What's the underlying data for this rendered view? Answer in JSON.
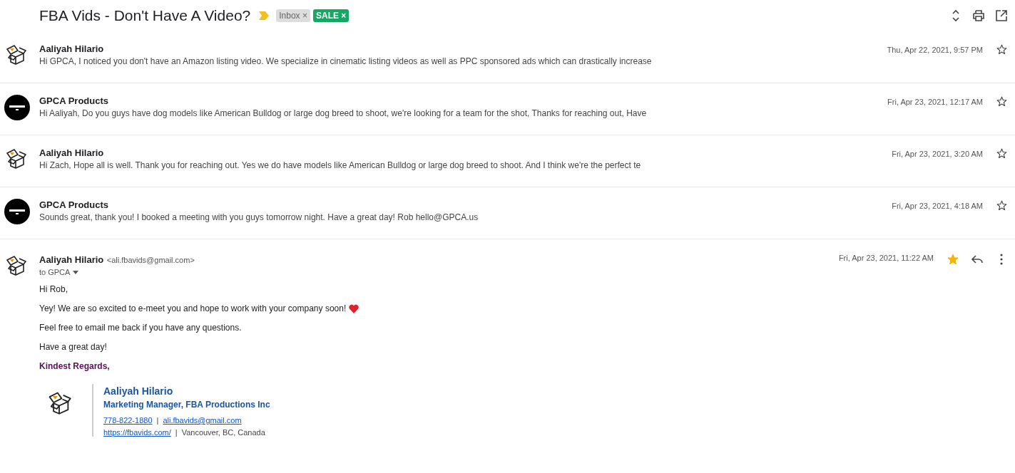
{
  "thread": {
    "subject": "FBA Vids - Don't Have A Video?",
    "important": true,
    "labels": [
      {
        "text": "Inbox",
        "kind": "inbox",
        "x": "×"
      },
      {
        "text": "SALE",
        "kind": "sale",
        "x": "×"
      }
    ]
  },
  "messages": [
    {
      "kind": "box",
      "sender": "Aaliyah Hilario",
      "snippet": "Hi GPCA, I noticed you don't have an Amazon listing video. We specialize in cinematic listing videos as well as PPC sponsored ads which can drastically increase",
      "date": "Thu, Apr 22, 2021, 9:57 PM",
      "starred": false
    },
    {
      "kind": "logo",
      "sender": "GPCA Products",
      "snippet": "Hi Aaliyah, Do you guys have dog models like American Bulldog or large dog breed to shoot, we're looking for a team for the shot, Thanks for reaching out, Have",
      "date": "Fri, Apr 23, 2021, 12:17 AM",
      "starred": false
    },
    {
      "kind": "box",
      "sender": "Aaliyah Hilario",
      "snippet": "Hi Zach, Hope all is well. Thank you for reaching out. Yes we do have models like American Bulldog or large dog breed to shoot. And I think we're the perfect te",
      "date": "Fri, Apr 23, 2021, 3:20 AM",
      "starred": false
    },
    {
      "kind": "logo",
      "sender": "GPCA Products",
      "snippet": "Sounds great, thank you! I booked a meeting with you guys tomorrow night. Have a great day! Rob hello@GPCA.us",
      "date": "Fri, Apr 23, 2021, 4:18 AM",
      "starred": false
    }
  ],
  "open_message": {
    "kind": "box",
    "sender": "Aaliyah Hilario",
    "email": "<ali.fbavids@gmail.com>",
    "to": "to GPCA",
    "date": "Fri, Apr 23, 2021, 11:22 AM",
    "starred": true,
    "body": [
      {
        "kind": "text",
        "text": "Hi Rob,"
      },
      {
        "kind": "heart",
        "text": "Yey! We are so excited to e-meet you and hope to work with your company soon!"
      },
      {
        "kind": "text",
        "text": "Feel free to email me back if you have any questions."
      },
      {
        "kind": "text",
        "text": "Have a great day!"
      },
      {
        "kind": "signoff",
        "text": "Kindest Regards,"
      }
    ],
    "signature": {
      "name": "Aaliyah Hilario",
      "title": "Marketing Manager, FBA Productions Inc",
      "lines": [
        [
          {
            "kind": "link",
            "text": "778-822-1880"
          },
          {
            "kind": "sep",
            "text": "|"
          },
          {
            "kind": "link",
            "text": "ali.fbavids@gmail.com"
          }
        ],
        [
          {
            "kind": "link",
            "text": "https://fbavids.com/"
          },
          {
            "kind": "sep",
            "text": "|"
          },
          {
            "kind": "text",
            "text": "Vancouver, BC, Canada"
          }
        ]
      ]
    }
  }
}
